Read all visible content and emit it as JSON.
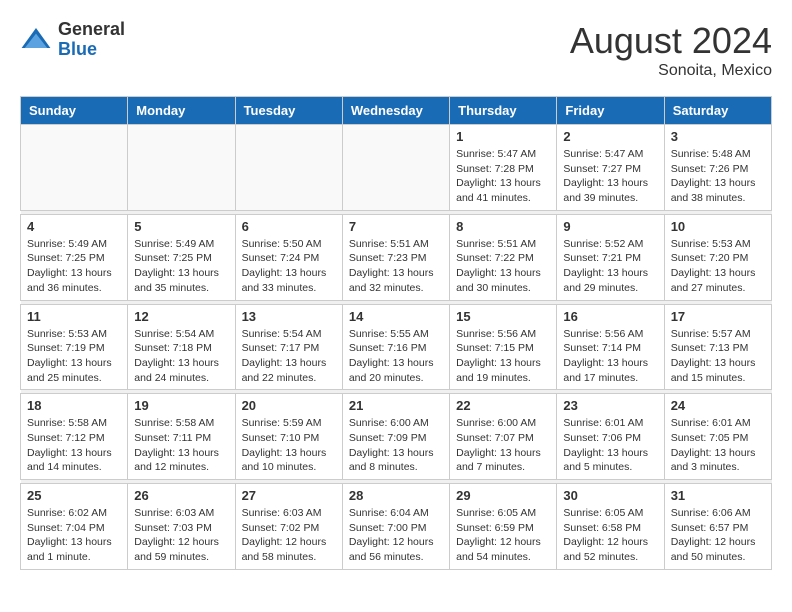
{
  "header": {
    "logo": {
      "general": "General",
      "blue": "Blue"
    },
    "title": "August 2024",
    "location": "Sonoita, Mexico"
  },
  "calendar": {
    "headers": [
      "Sunday",
      "Monday",
      "Tuesday",
      "Wednesday",
      "Thursday",
      "Friday",
      "Saturday"
    ],
    "weeks": [
      {
        "days": [
          {
            "num": "",
            "info": "",
            "empty": true
          },
          {
            "num": "",
            "info": "",
            "empty": true
          },
          {
            "num": "",
            "info": "",
            "empty": true
          },
          {
            "num": "",
            "info": "",
            "empty": true
          },
          {
            "num": "1",
            "info": "Sunrise: 5:47 AM\nSunset: 7:28 PM\nDaylight: 13 hours\nand 41 minutes.",
            "empty": false
          },
          {
            "num": "2",
            "info": "Sunrise: 5:47 AM\nSunset: 7:27 PM\nDaylight: 13 hours\nand 39 minutes.",
            "empty": false
          },
          {
            "num": "3",
            "info": "Sunrise: 5:48 AM\nSunset: 7:26 PM\nDaylight: 13 hours\nand 38 minutes.",
            "empty": false
          }
        ]
      },
      {
        "days": [
          {
            "num": "4",
            "info": "Sunrise: 5:49 AM\nSunset: 7:25 PM\nDaylight: 13 hours\nand 36 minutes.",
            "empty": false
          },
          {
            "num": "5",
            "info": "Sunrise: 5:49 AM\nSunset: 7:25 PM\nDaylight: 13 hours\nand 35 minutes.",
            "empty": false
          },
          {
            "num": "6",
            "info": "Sunrise: 5:50 AM\nSunset: 7:24 PM\nDaylight: 13 hours\nand 33 minutes.",
            "empty": false
          },
          {
            "num": "7",
            "info": "Sunrise: 5:51 AM\nSunset: 7:23 PM\nDaylight: 13 hours\nand 32 minutes.",
            "empty": false
          },
          {
            "num": "8",
            "info": "Sunrise: 5:51 AM\nSunset: 7:22 PM\nDaylight: 13 hours\nand 30 minutes.",
            "empty": false
          },
          {
            "num": "9",
            "info": "Sunrise: 5:52 AM\nSunset: 7:21 PM\nDaylight: 13 hours\nand 29 minutes.",
            "empty": false
          },
          {
            "num": "10",
            "info": "Sunrise: 5:53 AM\nSunset: 7:20 PM\nDaylight: 13 hours\nand 27 minutes.",
            "empty": false
          }
        ]
      },
      {
        "days": [
          {
            "num": "11",
            "info": "Sunrise: 5:53 AM\nSunset: 7:19 PM\nDaylight: 13 hours\nand 25 minutes.",
            "empty": false
          },
          {
            "num": "12",
            "info": "Sunrise: 5:54 AM\nSunset: 7:18 PM\nDaylight: 13 hours\nand 24 minutes.",
            "empty": false
          },
          {
            "num": "13",
            "info": "Sunrise: 5:54 AM\nSunset: 7:17 PM\nDaylight: 13 hours\nand 22 minutes.",
            "empty": false
          },
          {
            "num": "14",
            "info": "Sunrise: 5:55 AM\nSunset: 7:16 PM\nDaylight: 13 hours\nand 20 minutes.",
            "empty": false
          },
          {
            "num": "15",
            "info": "Sunrise: 5:56 AM\nSunset: 7:15 PM\nDaylight: 13 hours\nand 19 minutes.",
            "empty": false
          },
          {
            "num": "16",
            "info": "Sunrise: 5:56 AM\nSunset: 7:14 PM\nDaylight: 13 hours\nand 17 minutes.",
            "empty": false
          },
          {
            "num": "17",
            "info": "Sunrise: 5:57 AM\nSunset: 7:13 PM\nDaylight: 13 hours\nand 15 minutes.",
            "empty": false
          }
        ]
      },
      {
        "days": [
          {
            "num": "18",
            "info": "Sunrise: 5:58 AM\nSunset: 7:12 PM\nDaylight: 13 hours\nand 14 minutes.",
            "empty": false
          },
          {
            "num": "19",
            "info": "Sunrise: 5:58 AM\nSunset: 7:11 PM\nDaylight: 13 hours\nand 12 minutes.",
            "empty": false
          },
          {
            "num": "20",
            "info": "Sunrise: 5:59 AM\nSunset: 7:10 PM\nDaylight: 13 hours\nand 10 minutes.",
            "empty": false
          },
          {
            "num": "21",
            "info": "Sunrise: 6:00 AM\nSunset: 7:09 PM\nDaylight: 13 hours\nand 8 minutes.",
            "empty": false
          },
          {
            "num": "22",
            "info": "Sunrise: 6:00 AM\nSunset: 7:07 PM\nDaylight: 13 hours\nand 7 minutes.",
            "empty": false
          },
          {
            "num": "23",
            "info": "Sunrise: 6:01 AM\nSunset: 7:06 PM\nDaylight: 13 hours\nand 5 minutes.",
            "empty": false
          },
          {
            "num": "24",
            "info": "Sunrise: 6:01 AM\nSunset: 7:05 PM\nDaylight: 13 hours\nand 3 minutes.",
            "empty": false
          }
        ]
      },
      {
        "days": [
          {
            "num": "25",
            "info": "Sunrise: 6:02 AM\nSunset: 7:04 PM\nDaylight: 13 hours\nand 1 minute.",
            "empty": false
          },
          {
            "num": "26",
            "info": "Sunrise: 6:03 AM\nSunset: 7:03 PM\nDaylight: 12 hours\nand 59 minutes.",
            "empty": false
          },
          {
            "num": "27",
            "info": "Sunrise: 6:03 AM\nSunset: 7:02 PM\nDaylight: 12 hours\nand 58 minutes.",
            "empty": false
          },
          {
            "num": "28",
            "info": "Sunrise: 6:04 AM\nSunset: 7:00 PM\nDaylight: 12 hours\nand 56 minutes.",
            "empty": false
          },
          {
            "num": "29",
            "info": "Sunrise: 6:05 AM\nSunset: 6:59 PM\nDaylight: 12 hours\nand 54 minutes.",
            "empty": false
          },
          {
            "num": "30",
            "info": "Sunrise: 6:05 AM\nSunset: 6:58 PM\nDaylight: 12 hours\nand 52 minutes.",
            "empty": false
          },
          {
            "num": "31",
            "info": "Sunrise: 6:06 AM\nSunset: 6:57 PM\nDaylight: 12 hours\nand 50 minutes.",
            "empty": false
          }
        ]
      }
    ]
  }
}
